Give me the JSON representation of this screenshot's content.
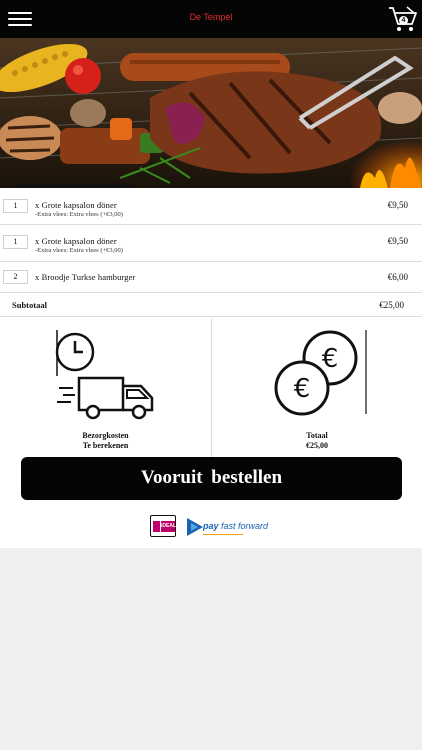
{
  "header": {
    "brand": "De Tempel",
    "cart_count": "4"
  },
  "order": {
    "items": [
      {
        "qty": "1",
        "name": "x Grote  kapsalon  döner",
        "sub": "-Extra vlees: Extra vlees (+€3,00)",
        "price": "€9,50"
      },
      {
        "qty": "1",
        "name": "x Grote  kapsalon  döner",
        "sub": "-Extra vlees: Extra vlees (+€3,00)",
        "price": "€9,50"
      },
      {
        "qty": "2",
        "name": "x Broodje  Turkse  hamburger",
        "sub": "",
        "price": "€6,00"
      }
    ],
    "subtotal_label": "Subtotaal",
    "subtotal_value": "€25,00"
  },
  "info": {
    "delivery_label": "Bezorgkosten",
    "delivery_value": "Te berekenen",
    "total_label": "Totaal",
    "total_value": "€25,00"
  },
  "actions": {
    "order_label": "Vooruit  bestellen"
  },
  "payment": {
    "ideal_text": "iDEAL",
    "ppf_pay": "pay",
    "ppf_rest": " fast forward"
  },
  "colors": {
    "topbar": "#050505",
    "brand": "#e62a2a",
    "button": "#050505",
    "ideal": "#c0006a",
    "ppf_blue": "#1a63b3"
  },
  "icons": [
    "menu-icon",
    "cart-icon",
    "delivery-truck-icon",
    "euro-coins-icon",
    "ideal-logo",
    "pay-fast-forward-logo"
  ]
}
